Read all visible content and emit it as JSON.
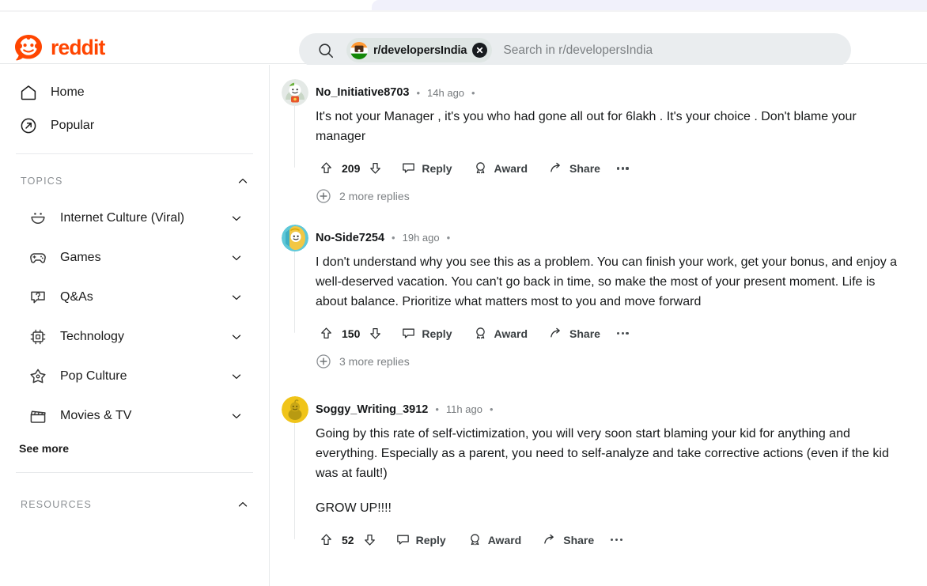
{
  "browser": {
    "tab_strip_color": "#f1f1fb"
  },
  "brand": {
    "name": "reddit",
    "accent_color": "#FF4500",
    "logo_icon": "reddit-snoo-logo"
  },
  "search": {
    "icon": "search-icon",
    "chip_label": "r/developersIndia",
    "chip_avatar_icon": "subreddit-avatar-india-flag",
    "chip_close_icon": "close-circle-icon",
    "placeholder": "Search in r/developersIndia"
  },
  "sidebar": {
    "nav": [
      {
        "label": "Home",
        "icon": "home-icon"
      },
      {
        "label": "Popular",
        "icon": "popular-arrow-icon"
      }
    ],
    "topics_section": {
      "title": "TOPICS",
      "collapse_icon": "chevron-up-icon",
      "items": [
        {
          "label": "Internet Culture (Viral)",
          "icon": "smiley-face-icon",
          "chevron": "chevron-down-icon"
        },
        {
          "label": "Games",
          "icon": "game-controller-icon",
          "chevron": "chevron-down-icon"
        },
        {
          "label": "Q&As",
          "icon": "question-bubble-icon",
          "chevron": "chevron-down-icon"
        },
        {
          "label": "Technology",
          "icon": "cpu-chip-icon",
          "chevron": "chevron-down-icon"
        },
        {
          "label": "Pop Culture",
          "icon": "star-icon",
          "chevron": "chevron-down-icon"
        },
        {
          "label": "Movies & TV",
          "icon": "clapperboard-icon",
          "chevron": "chevron-down-icon"
        }
      ],
      "see_more": "See more"
    },
    "resources_section": {
      "title": "RESOURCES",
      "collapse_icon": "chevron-up-icon"
    }
  },
  "feed": {
    "action_labels": {
      "reply": "Reply",
      "award": "Award",
      "share": "Share",
      "upvote_icon": "upvote-arrow-icon",
      "downvote_icon": "downvote-arrow-icon",
      "reply_icon": "comment-bubble-icon",
      "award_icon": "award-badge-icon",
      "share_icon": "share-arrow-icon",
      "more_icon": "ellipsis-icon"
    },
    "comments": [
      {
        "author": "No_Initiative8703",
        "timestamp": "14h ago",
        "avatar_icon": "user-avatar-gray-snoo",
        "avatar_bg": "#e4e9e6",
        "votes": "209",
        "paragraphs": [
          "It's not your Manager , it's you who had gone all out for 6lakh . It's your choice . Don't blame your manager"
        ],
        "more_replies": "2 more replies",
        "more_replies_icon": "plus-circle-icon"
      },
      {
        "author": "No-Side7254",
        "timestamp": "19h ago",
        "avatar_icon": "user-avatar-yellow-snoo",
        "avatar_bg": "#f2c744",
        "votes": "150",
        "paragraphs": [
          "I don't understand why you see this as a problem. You can finish your work, get your bonus, and enjoy a well-deserved vacation. You can't go back in time, so make the most of your present moment. Life is about balance. Prioritize what matters most to you and move forward"
        ],
        "more_replies": "3 more replies",
        "more_replies_icon": "plus-circle-icon"
      },
      {
        "author": "Soggy_Writing_3912",
        "timestamp": "11h ago",
        "avatar_icon": "user-avatar-gold-snoo",
        "avatar_bg": "#f0c419",
        "votes": "52",
        "paragraphs": [
          "Going by this rate of self-victimization, you will very soon start blaming your kid for anything and everything. Especially as a parent, you need to self-analyze and take corrective actions (even if the kid was at fault!)",
          "GROW UP!!!!"
        ],
        "more_replies": null,
        "more_replies_icon": null
      }
    ]
  }
}
